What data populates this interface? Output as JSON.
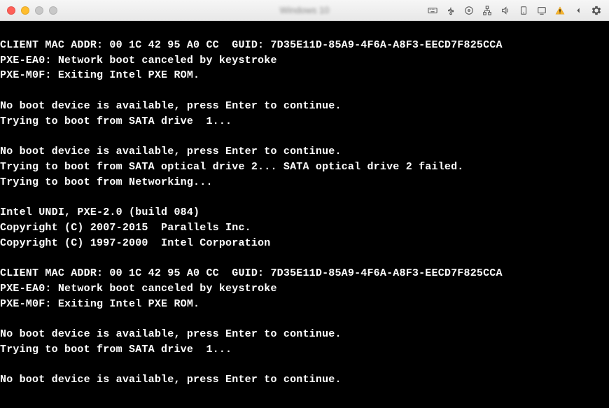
{
  "window": {
    "title": "Windows 10"
  },
  "terminal": {
    "lines": [
      "",
      "CLIENT MAC ADDR: 00 1C 42 95 A0 CC  GUID: 7D35E11D-85A9-4F6A-A8F3-EECD7F825CCA",
      "PXE-EA0: Network boot canceled by keystroke",
      "PXE-M0F: Exiting Intel PXE ROM.",
      "",
      "No boot device is available, press Enter to continue.",
      "Trying to boot from SATA drive  1...",
      "",
      "No boot device is available, press Enter to continue.",
      "Trying to boot from SATA optical drive 2... SATA optical drive 2 failed.",
      "Trying to boot from Networking...",
      "",
      "Intel UNDI, PXE-2.0 (build 084)",
      "Copyright (C) 2007-2015  Parallels Inc.",
      "Copyright (C) 1997-2000  Intel Corporation",
      "",
      "CLIENT MAC ADDR: 00 1C 42 95 A0 CC  GUID: 7D35E11D-85A9-4F6A-A8F3-EECD7F825CCA",
      "PXE-EA0: Network boot canceled by keystroke",
      "PXE-M0F: Exiting Intel PXE ROM.",
      "",
      "No boot device is available, press Enter to continue.",
      "Trying to boot from SATA drive  1...",
      "",
      "No boot device is available, press Enter to continue."
    ]
  }
}
